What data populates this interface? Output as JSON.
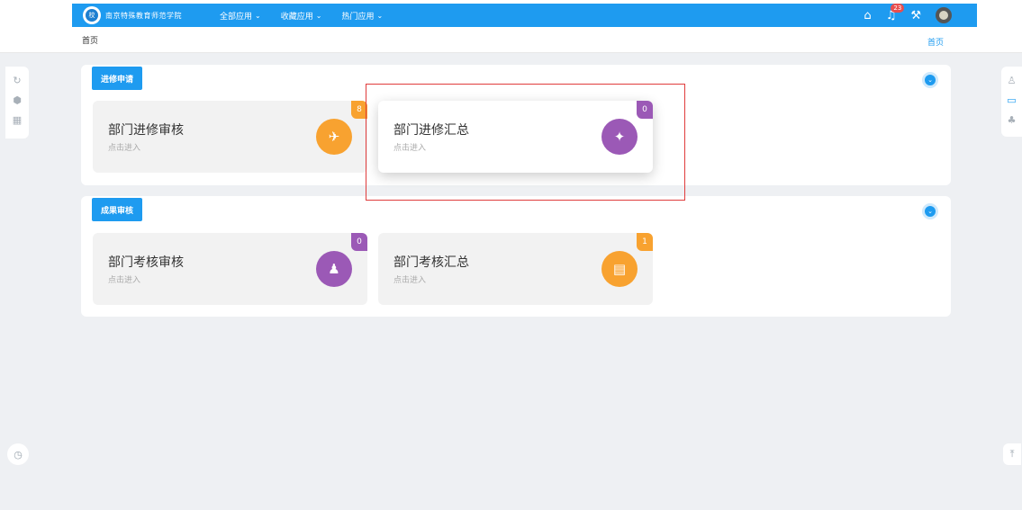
{
  "header": {
    "logo_mark": "校",
    "logo_text": "南京特殊教育师范学院",
    "nav": [
      {
        "label": "全部应用"
      },
      {
        "label": "收藏应用"
      },
      {
        "label": "热门应用"
      }
    ],
    "notification_count": "23"
  },
  "breadcrumb": {
    "current": "首页",
    "home_link": "首页"
  },
  "sections": [
    {
      "tag": "进修申请",
      "cards": [
        {
          "title": "部门进修审核",
          "subtitle": "点击进入",
          "badge": "8",
          "icon": "plane-icon",
          "color": "#f8a230"
        },
        {
          "title": "部门进修汇总",
          "subtitle": "点击进入",
          "badge": "0",
          "icon": "map-icon",
          "color": "#9b59b6"
        }
      ]
    },
    {
      "tag": "成果审核",
      "cards": [
        {
          "title": "部门考核审核",
          "subtitle": "点击进入",
          "badge": "0",
          "icon": "user-check-icon",
          "color": "#9b59b6"
        },
        {
          "title": "部门考核汇总",
          "subtitle": "点击进入",
          "badge": "1",
          "icon": "document-icon",
          "color": "#f8a230"
        }
      ]
    }
  ],
  "colors": {
    "accent": "#1e9bf0",
    "orange": "#f8a230",
    "purple": "#9b59b6",
    "highlight": "#e03c3c"
  }
}
